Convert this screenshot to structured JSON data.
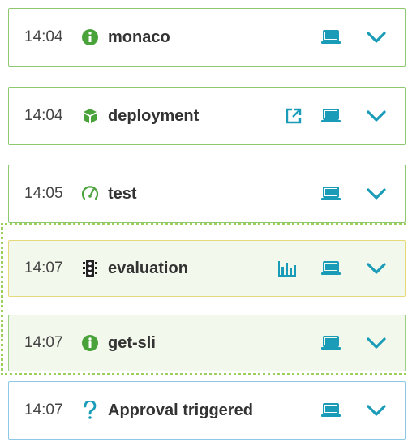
{
  "colors": {
    "accent_teal": "#1a9cb8",
    "success_green": "#4aa23a",
    "border_green": "#8dc86f",
    "border_yellow": "#e6d97a",
    "border_blue": "#8dc8e6"
  },
  "events": [
    {
      "time": "14:04",
      "icon": "info-circle-icon",
      "name": "monaco"
    },
    {
      "time": "14:04",
      "icon": "deployment-icon",
      "name": "deployment"
    },
    {
      "time": "14:05",
      "icon": "speedometer-icon",
      "name": "test"
    },
    {
      "time": "14:07",
      "icon": "traffic-light-icon",
      "name": "evaluation"
    },
    {
      "time": "14:07",
      "icon": "info-circle-icon",
      "name": "get-sli"
    },
    {
      "time": "14:07",
      "icon": "question-mark-icon",
      "name": "Approval triggered"
    }
  ]
}
